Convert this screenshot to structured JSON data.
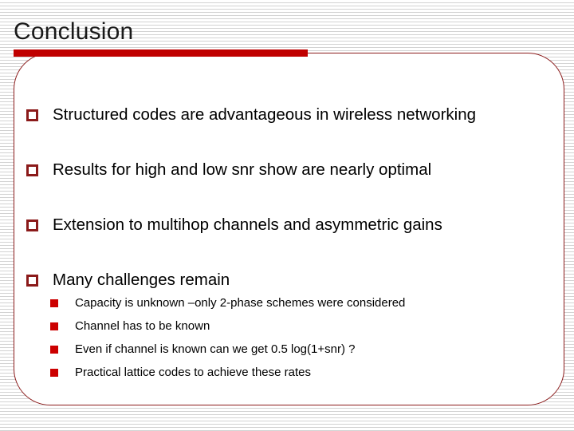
{
  "slide": {
    "title": "Conclusion",
    "accent_color": "#c00000",
    "frame_border_color": "#8b1a1a",
    "sub_bullet_color": "#cc0000",
    "text_color": "#000000",
    "background_color": "#ffffff"
  },
  "bullets": [
    {
      "level": 1,
      "marker": "hollow-square-bullet",
      "text": "Structured codes are advantageous in wireless networking"
    },
    {
      "level": 1,
      "marker": "hollow-square-bullet",
      "text": "Results for high and low snr show are nearly optimal"
    },
    {
      "level": 1,
      "marker": "hollow-square-bullet",
      "text": " Extension to multihop channels and asymmetric gains"
    },
    {
      "level": 1,
      "marker": "hollow-square-bullet",
      "text": " Many challenges remain"
    }
  ],
  "sub_bullets": [
    {
      "level": 2,
      "marker": "filled-square-bullet",
      "text": "Capacity is unknown –only 2-phase schemes were considered"
    },
    {
      "level": 2,
      "marker": "filled-square-bullet",
      "text": "Channel has to be known"
    },
    {
      "level": 2,
      "marker": "filled-square-bullet",
      "text": "Even if channel is known can we get 0.5 log(1+snr) ?"
    },
    {
      "level": 2,
      "marker": "filled-square-bullet",
      "text": "Practical lattice codes to achieve these rates"
    }
  ]
}
